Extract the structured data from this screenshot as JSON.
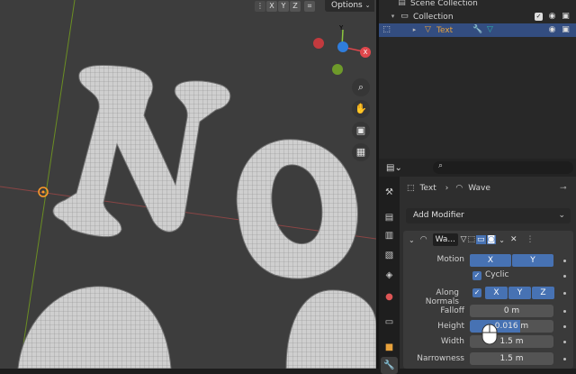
{
  "viewport": {
    "axis_buttons": [
      "X",
      "Y",
      "Z"
    ],
    "options_label": "Options",
    "gizmo": {
      "y_label": "Y",
      "x_label": "X"
    },
    "text_glyphs": "No"
  },
  "outliner": {
    "scene_collection": "Scene Collection",
    "collection": "Collection",
    "text_object": "Text"
  },
  "properties": {
    "search_placeholder": "",
    "breadcrumb_object": "Text",
    "breadcrumb_modifier": "Wave",
    "add_modifier": "Add Modifier",
    "modifier_name": "Wa...",
    "motion_label": "Motion",
    "motion_x": "X",
    "motion_y": "Y",
    "cyclic_label": "Cyclic",
    "along_normals_label": "Along Normals",
    "normals_x": "X",
    "normals_y": "Y",
    "normals_z": "Z",
    "falloff_label": "Falloff",
    "falloff_value": "0 m",
    "height_label": "Height",
    "height_value": "0.016 m",
    "height_fill_fraction": 0.6,
    "width_label": "Width",
    "width_value": "1.5 m",
    "narrowness_label": "Narrowness",
    "narrowness_value": "1.5 m"
  },
  "colors": {
    "selection": "#334d80",
    "accent_blue": "#4772b3",
    "object_orange": "#e8a23c",
    "modifier_teal": "#2fb3a8"
  }
}
